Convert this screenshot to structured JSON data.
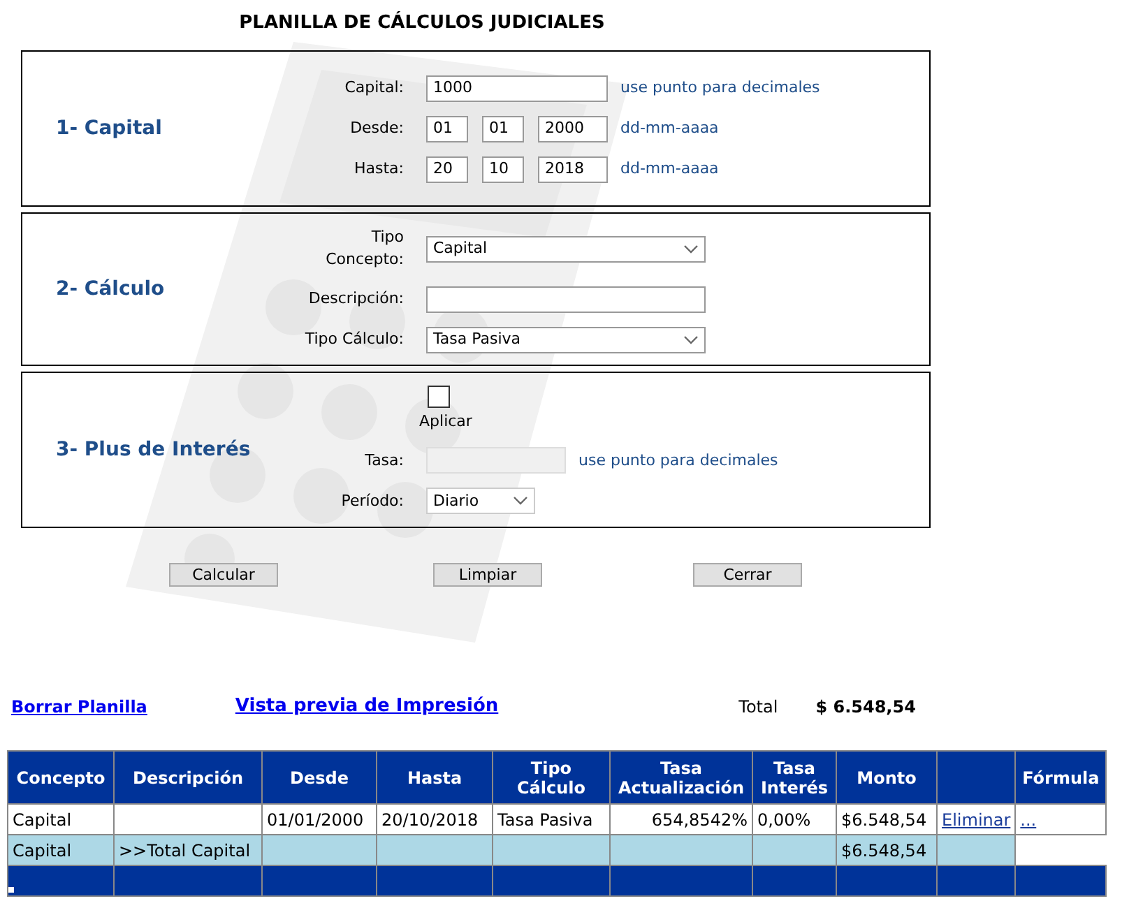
{
  "title": "PLANILLA DE CÁLCULOS JUDICIALES",
  "sections": [
    {
      "heading": "1- Capital",
      "rows": [
        {
          "kind": "text",
          "label": "Capital:",
          "value": "1000",
          "hint": "use punto para decimales"
        },
        {
          "kind": "date",
          "label": "Desde:",
          "values": [
            "01",
            "01",
            "2000"
          ],
          "hint": "dd-mm-aaaa"
        },
        {
          "kind": "date",
          "label": "Hasta:",
          "values": [
            "20",
            "10",
            "2018"
          ],
          "hint": "dd-mm-aaaa"
        }
      ]
    },
    {
      "heading": "2- Cálculo",
      "rows": [
        {
          "kind": "select",
          "label": "Tipo Concepto:",
          "value": "Capital"
        },
        {
          "kind": "wide_text",
          "label": "Descripción:"
        },
        {
          "kind": "select",
          "label": "Tipo Cálculo:",
          "value": "Tasa Pasiva"
        }
      ]
    },
    {
      "heading": "3- Plus de Interés",
      "rows": [
        {
          "kind": "checkbox",
          "caption": "Aplicar",
          "checked": false
        },
        {
          "kind": "disabled_text",
          "label": "Tasa:",
          "hint": "use punto para decimales",
          "disabled": true
        },
        {
          "kind": "small_select",
          "label": "Período:",
          "value": "Diario"
        }
      ]
    }
  ],
  "buttons": [
    "Calcular",
    "Limpiar",
    "Cerrar"
  ],
  "links": [
    "Borrar Planilla",
    "Vista previa de Impresión"
  ],
  "total": {
    "label": "Total",
    "value": "$ 6.548,54"
  },
  "table": {
    "columns": [
      "Concepto",
      "Descripción",
      "Desde",
      "Hasta",
      "Tipo Cálculo",
      "Tasa Actualización",
      "Tasa Interés",
      "Monto",
      null,
      "Fórmula"
    ],
    "rows": [
      {
        "kind": "data",
        "cells": [
          {
            "kind": "text",
            "text": "Capital"
          },
          null,
          {
            "kind": "text",
            "text": "01/01/2000"
          },
          {
            "kind": "text",
            "text": "20/10/2018"
          },
          {
            "kind": "text",
            "text": "Tasa Pasiva"
          },
          {
            "kind": "number",
            "text": "654,8542%"
          },
          {
            "kind": "text",
            "text": "0,00%"
          },
          {
            "kind": "text",
            "text": "$6.548,54"
          },
          {
            "kind": "link",
            "text": "Eliminar"
          },
          {
            "kind": "link",
            "text": "..."
          }
        ]
      },
      {
        "kind": "subtotal",
        "cells": [
          {
            "kind": "text",
            "text": "Capital"
          },
          {
            "kind": "text",
            "text": ">>Total Capital"
          },
          null,
          null,
          null,
          null,
          null,
          {
            "kind": "text",
            "text": "$6.548,54"
          },
          null
        ]
      },
      {
        "kind": "footer"
      }
    ]
  }
}
